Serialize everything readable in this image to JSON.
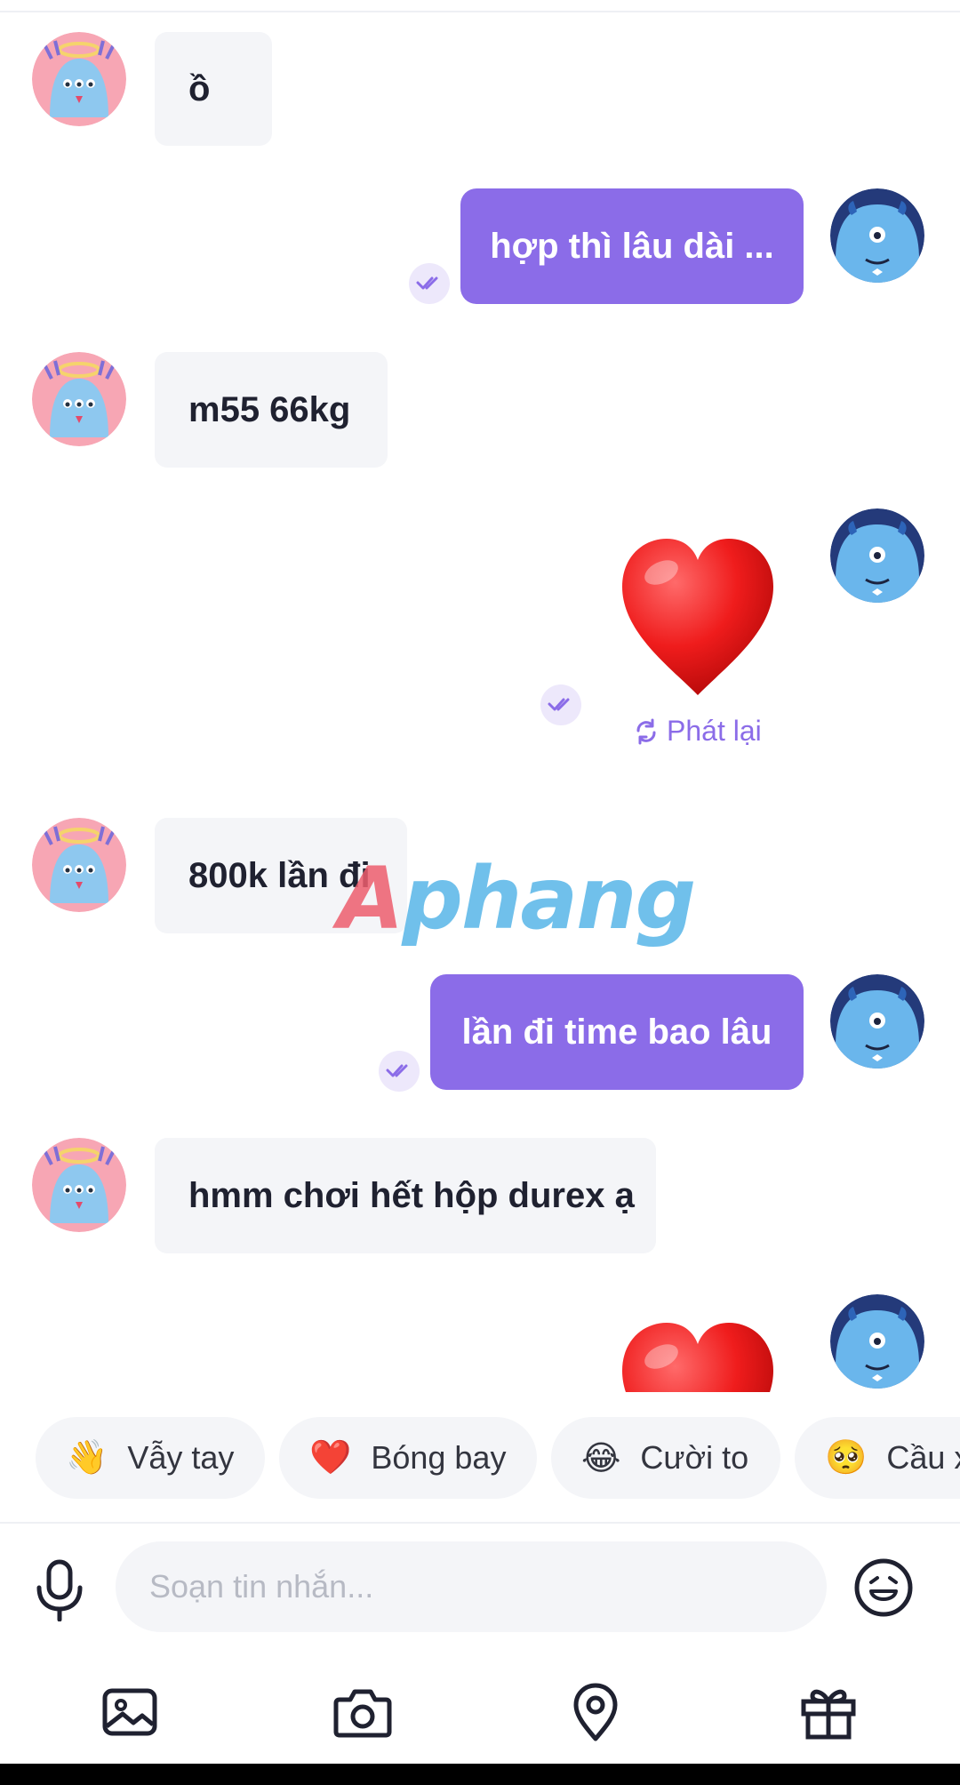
{
  "messages": [
    {
      "side": "in",
      "text": "ồ"
    },
    {
      "side": "out",
      "text": "hợp thì lâu dài ..."
    },
    {
      "side": "in",
      "text": "m55 66kg"
    },
    {
      "side": "out",
      "type": "heart-sticker",
      "replay_label": "Phát lại"
    },
    {
      "side": "in",
      "text": "800k lần đi"
    },
    {
      "side": "out",
      "text": "lần đi time bao lâu"
    },
    {
      "side": "in",
      "text": "hmm chơi hết hộp durex ạ"
    },
    {
      "side": "out",
      "type": "heart-sticker"
    }
  ],
  "watermark": {
    "first": "A",
    "rest": "phang"
  },
  "quick_replies": [
    {
      "emoji": "👋",
      "label": "Vẫy tay"
    },
    {
      "emoji": "❤️",
      "label": "Bóng bay"
    },
    {
      "emoji": "😂",
      "label": "Cười to"
    },
    {
      "emoji": "🥺",
      "label": "Cầu x"
    }
  ],
  "composer": {
    "placeholder": "Soạn tin nhắn..."
  },
  "toolbar": [
    "image-icon",
    "camera-icon",
    "location-icon",
    "gift-icon"
  ],
  "colors": {
    "accent": "#8b6ce8",
    "incoming_bubble": "#f4f5f8",
    "avatar_in_bg": "#f7a6b4",
    "avatar_out_bg": "#243a7a"
  }
}
